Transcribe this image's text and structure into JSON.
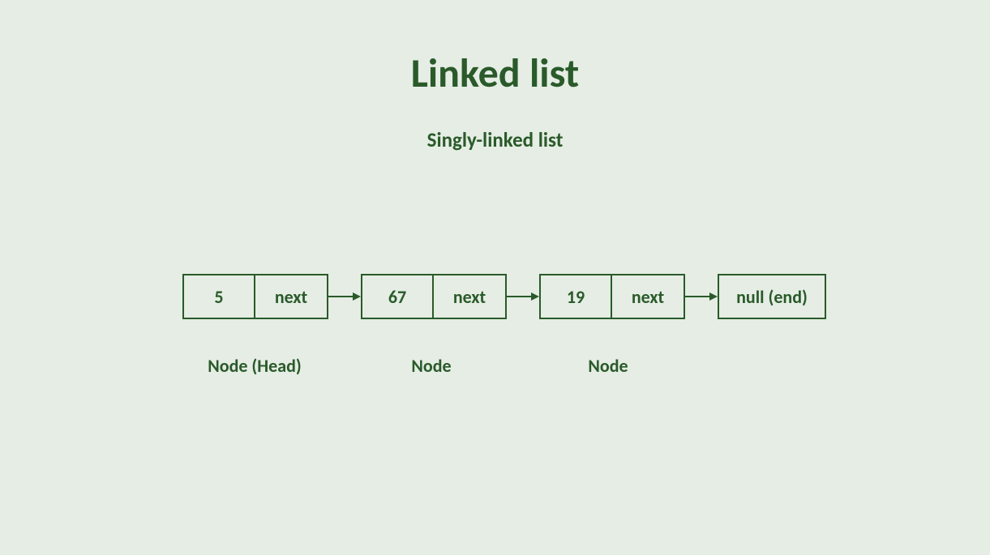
{
  "title": "Linked list",
  "subtitle": "Singly-linked list",
  "nodes": [
    {
      "value": "5",
      "next_label": "next",
      "caption": "Node (Head)"
    },
    {
      "value": "67",
      "next_label": "next",
      "caption": "Node"
    },
    {
      "value": "19",
      "next_label": "next",
      "caption": "Node"
    }
  ],
  "terminator": "null (end)",
  "colors": {
    "fg": "#2a5a2a",
    "bg": "#e5ede4"
  }
}
